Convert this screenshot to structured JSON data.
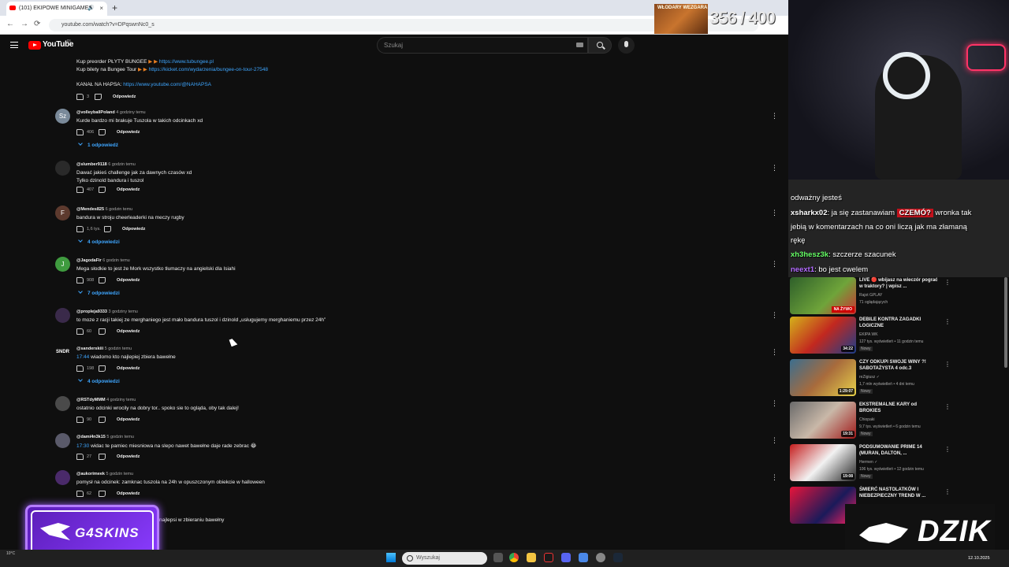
{
  "browser": {
    "tab_title": "(101) EKIPOWE MINIGAMES",
    "tab_close": "×",
    "new_tab": "+",
    "url": "youtube.com/watch?v=DPqswnNc0_s",
    "back": "←",
    "forward": "→",
    "reload": "⟳"
  },
  "youtube": {
    "logo_text": "YouTube",
    "country": "PL",
    "search_placeholder": "Szukaj"
  },
  "pinned": {
    "line1_prefix": "Kup preorder PŁYTY BUNGEE",
    "line1_link": "https://www.tubungee.pl",
    "line2_prefix": "Kup bilety na Bungee Tour",
    "line2_link": "https://kicket.com/wydarzenia/bungee-on-tour-27548",
    "line3_prefix": "KANAŁ NA HAPSA:",
    "line3_link": "https://www.youtube.com/@NAHAPSA",
    "likes": "3",
    "reply": "Odpowiedz"
  },
  "comments": [
    {
      "author": "@volleyballPoland",
      "time": "4 godziny temu",
      "text": "Kurde bardzo mi brakuje Tuszola w takich odcinkach xd",
      "likes": "406",
      "reply": "Odpowiedz",
      "replies": "1 odpowiedź",
      "avatar": "Sz",
      "color": "#7a8a9a"
    },
    {
      "author": "@slumber9118",
      "time": "6 godzin temu",
      "text": "Dawać jakieś challenge jak za dawnych czasów xd",
      "text2": "Tylko dzinold bandura i tuszol",
      "likes": "407",
      "reply": "Odpowiedz",
      "avatar": "",
      "color": "#2a2a2a"
    },
    {
      "author": "@Mendes825",
      "time": "6 godzin temu",
      "text": "bandura w stroju cheerleaderki na meczy rugby",
      "likes": "1,6 tys.",
      "reply": "Odpowiedz",
      "replies": "4 odpowiedzi",
      "avatar": "F",
      "color": "#5d3a2e"
    },
    {
      "author": "@JagodaFir",
      "time": "6 godzin temu",
      "text": "Mega słodkie to jest że Mork wszystko tłumaczy na angielski dla Isiahi",
      "likes": "908",
      "reply": "Odpowiedz",
      "replies": "7 odpowiedzi",
      "avatar": "J",
      "color": "#3f9b3f"
    },
    {
      "author": "@propleja9333",
      "time": "3 godziny temu",
      "text": "to moze z racji takiej ze merghaniego jest mało bandura tuszol i dzinold „usługujemy merghaniemu przez 24h”",
      "likes": "60",
      "reply": "Odpowiedz",
      "avatar": "",
      "color": "#3a2a4a"
    },
    {
      "author": "@sanderskiii",
      "time": "5 godzin temu",
      "timestamp": "17:44",
      "text": " wiadomo kto najlepiej zbiera bawełne",
      "likes": "198",
      "reply": "Odpowiedz",
      "replies": "4 odpowiedzi",
      "avatar": "SNDR",
      "color": "#0f0f0f"
    },
    {
      "author": "@RSTdyMMM",
      "time": "4 godziny temu",
      "text": "ostatnio odcinki wrocily na dobry tor.. spoko sie to ogląda, oby tak dalej!",
      "likes": "90",
      "reply": "Odpowiedz",
      "avatar": "",
      "color": "#4a4a4a"
    },
    {
      "author": "@dami4n3k15",
      "time": "5 godzin temu",
      "timestamp": "17:30",
      "text": " widac te pamiec miesniowa na slepo nawet bawełne daje rade zebrac 😂",
      "likes": "27",
      "reply": "Odpowiedz",
      "avatar": "",
      "color": "#5a5a6a"
    },
    {
      "author": "@aukorimeek",
      "time": "5 godzin temu",
      "text": "pomysł na odcinek: zamknac tuszola na 24h w opuszczonym obiekcie w halloween",
      "likes": "62",
      "reply": "Odpowiedz",
      "avatar": "",
      "color": "#4a2a6a"
    },
    {
      "text": "najlepsi w zbieraniu bawełny"
    }
  ],
  "overlay": {
    "counter": "356 / 400",
    "counter_art": "WŁODARY WEZGARA"
  },
  "chat": [
    {
      "name": "",
      "text": "odważny jesteś",
      "name_color": "#ff4d4d"
    },
    {
      "name": "xsharkx02",
      "text": ": ja się zastanawiam ",
      "tag": "CZEMÓ?",
      "text_after": " wronka tak",
      "name_color": "#ffffff"
    },
    {
      "name": "",
      "text": "jebią w komentarzach na co oni liczą jak ma złamaną",
      "name_color": "#ffffff"
    },
    {
      "name": "",
      "text": "rękę",
      "name_color": "#ffffff"
    },
    {
      "name": "xh3hesz3k",
      "text": ": szczerze szacunek",
      "name_color": "#66ff66"
    },
    {
      "name": "neext1",
      "text": ": bo jest cwelem",
      "name_color": "#b36bff"
    }
  ],
  "sidebar": [
    {
      "title": "LIVE 🔴 wbijasz na wieczór pograć w traktory? | wpisz ...",
      "channel": "Rajot GPLAY",
      "meta": "71 oglądających",
      "badge": "",
      "duration": "NA ŻYWO",
      "live": true,
      "thumb": "linear-gradient(135deg,#2e5f2a,#6fa43a 60%,#c33)"
    },
    {
      "title": "DEBILE KONTRA ZAGADKI LOGICZNE",
      "channel": "EKIPA WK",
      "meta": "127 tys. wyświetleń • 11 godzin temu",
      "badge": "Nowy",
      "duration": "34:22",
      "live": false,
      "thumb": "linear-gradient(135deg,#d4b21a,#c2281f 50%,#1c3e8a)"
    },
    {
      "title": "CZY ODKUPI SWOJE WINY ?! SABOTAŻYSTA 4 odc.3",
      "channel": "reZigiusz ✓",
      "meta": "1,7 mln wyświetleń • 4 dni temu",
      "badge": "Nowy",
      "duration": "1:29:07",
      "live": false,
      "thumb": "linear-gradient(135deg,#3b6e8f,#a86b3c 50%,#e8d24a)"
    },
    {
      "title": "EKSTREMALNE KARY od BROKIES",
      "channel": "Chiopaki",
      "meta": "9,7 tys. wyświetleń • 6 godzin temu",
      "badge": "Nowy",
      "duration": "19:31",
      "live": false,
      "thumb": "linear-gradient(135deg,#6a6a6a,#c9b8a8 50%,#a01818)"
    },
    {
      "title": "PODSUMOWANIE PRIME 14 (MURAN, DALTON, ...",
      "channel": "Hermen ✓",
      "meta": "106 tys. wyświetleń • 12 godzin temu",
      "badge": "Nowy",
      "duration": "19:08",
      "live": false,
      "thumb": "linear-gradient(135deg,#c51d1d,#f2f2f2 50%,#222)"
    },
    {
      "title": "ŚMIERĆ NASTOLATKÓW I NIEBEZPIECZNY TREND W ...",
      "channel": "",
      "meta": "",
      "badge": "",
      "duration": "",
      "live": false,
      "thumb": "linear-gradient(135deg,#e8143a,#1a1a5a 60%,#ff2060)"
    }
  ],
  "sponsors": {
    "left": "G4SKINS",
    "right": "DZIK"
  },
  "taskbar": {
    "search_placeholder": "Wyszukaj",
    "time": "12.10.2025",
    "weather": "10°C"
  }
}
